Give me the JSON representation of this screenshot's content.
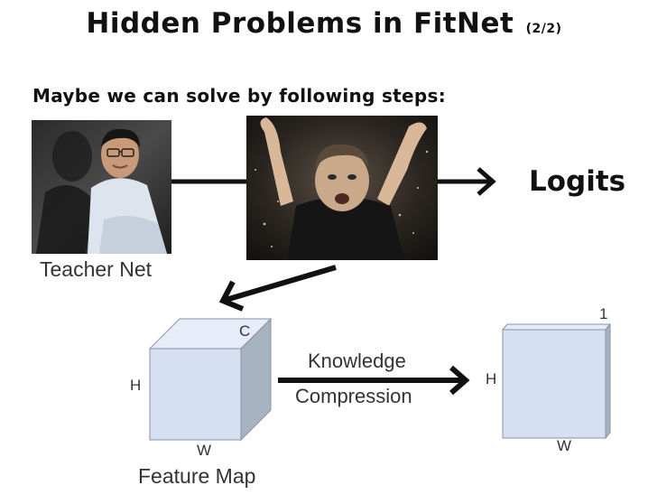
{
  "title": {
    "main": "Hidden Problems in FitNet",
    "part": "(2/2)"
  },
  "subtitle": "Maybe we can solve by following steps:",
  "teacher_photo": {
    "caption": "Teacher Net"
  },
  "middle_photo": {},
  "logits_label": "Logits",
  "feature_map": {
    "caption": "Feature Map",
    "h": "H",
    "w": "W",
    "c": "C"
  },
  "compression": {
    "line1": "Knowledge",
    "line2": "Compression"
  },
  "compressed_map": {
    "h": "H",
    "w": "W",
    "depth": "1"
  },
  "colors": {
    "box_face": "#d5e1f3",
    "box_top": "#e6edf8",
    "box_side": "#a8b3c2",
    "arrow": "#111111"
  }
}
